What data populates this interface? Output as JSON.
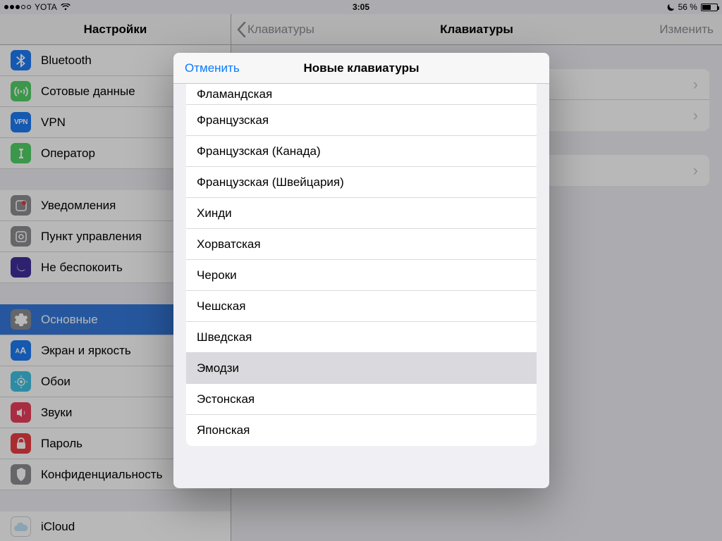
{
  "statusbar": {
    "carrier": "YOTA",
    "time": "3:05",
    "battery_pct": "56 %"
  },
  "sidebar": {
    "title": "Настройки",
    "items": [
      {
        "label": "Bluetooth"
      },
      {
        "label": "Сотовые данные"
      },
      {
        "label": "VPN"
      },
      {
        "label": "Оператор"
      },
      {
        "label": "Уведомления"
      },
      {
        "label": "Пункт управления"
      },
      {
        "label": "Не беспокоить"
      },
      {
        "label": "Основные"
      },
      {
        "label": "Экран и яркость"
      },
      {
        "label": "Обои"
      },
      {
        "label": "Звуки"
      },
      {
        "label": "Пароль"
      },
      {
        "label": "Конфиденциальность"
      },
      {
        "label": "iCloud"
      }
    ],
    "vpn_badge": "VPN",
    "disp_badge": "AA"
  },
  "detail": {
    "back_label": "Клавиатуры",
    "title": "Клавиатуры",
    "edit_label": "Изменить"
  },
  "modal": {
    "cancel": "Отменить",
    "title": "Новые клавиатуры",
    "options": [
      "Фламандская",
      "Французская",
      "Французская (Канада)",
      "Французская (Швейцария)",
      "Хинди",
      "Хорватская",
      "Чероки",
      "Чешская",
      "Шведская",
      "Эмодзи",
      "Эстонская",
      "Японская"
    ],
    "selected_index": 9
  }
}
